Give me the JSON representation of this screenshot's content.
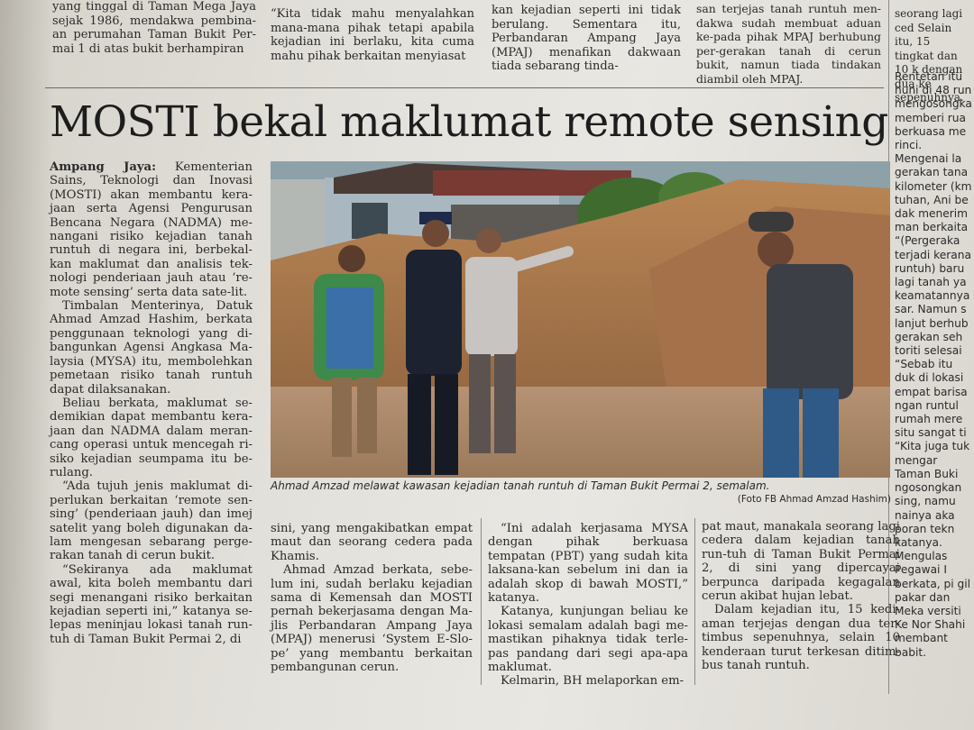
{
  "top_strip": {
    "col1": "yang tinggal di Taman Mega Jaya sejak 1986, mendakwa pembina-an perumahan Taman Bukit Per-mai 1 di atas bukit berhampiran",
    "col2": "“Kita tidak mahu menyalahkan mana-mana pihak tetapi apabila kejadian ini berlaku, kita cuma mahu pihak berkaitan menyiasat",
    "col3": "kan kejadian seperti ini tidak berulang. Sementara itu, Perbandaran Ampang Jaya (MPAJ) menafikan dakwaan tiada sebarang tinda-",
    "col4": "san terjejas tanah runtuh men-dakwa sudah membuat aduan ke-pada pihak MPAJ berhubung per-gerakan tanah di cerun bukit, namun tiada tindakan diambil oleh MPAJ.",
    "col5": "seorang lagi ced Selain itu, 15 tingkat dan 10 k dengan dua ke sepenuhnya."
  },
  "headline": "MOSTI bekal maklumat remote sensing",
  "article": {
    "dateline": "Ampang Jaya:",
    "col1": [
      "Kementerian Sains, Teknologi dan Inovasi (MOSTI) akan membantu kera-jaan serta Agensi Pengurusan Bencana Negara (NADMA) me-nangani risiko kejadian tanah runtuh di negara ini, berbekal-kan maklumat dan analisis tek-nologi penderiaan jauh atau ‘re-mote sensing’ serta data sate-lit.",
      "Timbalan Menterinya, Datuk Ahmad Amzad Hashim, berkata penggunaan teknologi yang di-bangunkan Agensi Angkasa Ma-laysia (MYSA) itu, membolehkan pemetaan risiko tanah runtuh dapat dilaksanakan.",
      "Beliau berkata, maklumat se-demikian dapat membantu kera-jaan dan NADMA dalam meran-cang operasi untuk mencegah ri-siko kejadian seumpama itu be-rulang.",
      "“Ada tujuh jenis maklumat di-perlukan berkaitan ‘remote sen-sing’ (penderiaan jauh) dan imej satelit yang boleh digunakan da-lam mengesan sebarang perge-rakan tanah di cerun bukit.",
      "“Sekiranya ada maklumat awal, kita boleh membantu dari segi menangani risiko berkaitan kejadian seperti ini,” katanya se-lepas meninjau lokasi tanah run-tuh di Taman Bukit Permai 2, di"
    ],
    "col2": [
      "sini, yang mengakibatkan empat maut dan seorang cedera pada Khamis.",
      "Ahmad Amzad berkata, sebe-lum ini, sudah berlaku kejadian sama di Kemensah dan MOSTI pernah bekerjasama dengan Ma-jlis Perbandaran Ampang Jaya (MPAJ) menerusi ‘System E-Slo-pe’ yang membantu berkaitan pembangunan cerun."
    ],
    "col3": [
      "“Ini adalah kerjasama MYSA dengan pihak berkuasa tempatan (PBT) yang sudah kita laksana-kan sebelum ini dan ia adalah skop di bawah MOSTI,” katanya.",
      "Katanya, kunjungan beliau ke lokasi semalam adalah bagi me-mastikan pihaknya tidak terle-pas pandang dari segi apa-apa maklumat.",
      "Kelmarin, BH melaporkan em-"
    ],
    "col4": [
      "pat maut, manakala seorang lagi cedera dalam kejadian tanah run-tuh di Taman Bukit Permai 2, di sini yang dipercayai berpunca daripada kegagalan cerun akibat hujan lebat.",
      "Dalam kejadian itu, 15 kedi-aman terjejas dengan dua ter-timbus sepenuhnya, selain 10 kenderaan turut terkesan ditim-bus tanah runtuh."
    ]
  },
  "photo": {
    "caption": "Ahmad Amzad melawat kawasan kejadian tanah runtuh di Taman Bukit Permai 2, semalam.",
    "credit": "(Foto FB Ahmad Amzad Hashim)"
  },
  "side_column": {
    "text": "Rentetan itu huni di 48 run mengosongka memberi rua berkuasa me rinci. Mengenai la gerakan tana kilometer (km tuhan, Ani be dak menerim man berkaita “(Pergeraka terjadi kerana runtuh) baru lagi tanah ya keamatannya sar. Namun s lanjut berhub gerakan seh toriti selesai “Sebab itu duk di lokasi empat barisa ngan runtul rumah mere situ sangat ti “Kita juga tuk mengar Taman Buki ngosongkan sing, namu nainya aka poran tekn katanya. Mengulas Pegawai I berkata, pi gil pakar dan Meka versiti Ke Nor Shahi membant babit."
  },
  "colors": {
    "paper": "#e6e4de",
    "ink": "#2a2a2a",
    "soil": "#a8774a"
  }
}
